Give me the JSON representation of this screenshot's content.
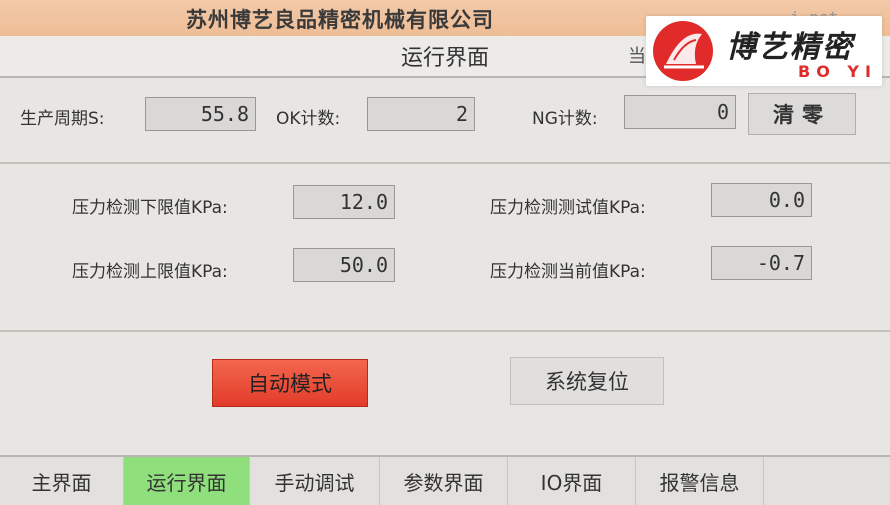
{
  "header": {
    "company": "苏州博艺良品精密机械有限公司",
    "site": "i.net",
    "title": "运行界面",
    "current_user_fragment": "当"
  },
  "logo": {
    "brand": "博艺精密",
    "sub": "BO YI",
    "accent_color": "#e12b2b"
  },
  "counters": {
    "cycle_label": "生产周期S:",
    "cycle_value": "55.8",
    "ok_label": "OK计数:",
    "ok_value": "2",
    "ng_label": "NG计数:",
    "ng_value": "0",
    "clear_label": "清零"
  },
  "pressure": {
    "lower_label": "压力检测下限值KPa:",
    "lower_value": "12.0",
    "upper_label": "压力检测上限值KPa:",
    "upper_value": "50.0",
    "test_label": "压力检测测试值KPa:",
    "test_value": "0.0",
    "current_label": "压力检测当前值KPa:",
    "current_value": "-0.7"
  },
  "actions": {
    "auto_mode": "自动模式",
    "system_reset": "系统复位",
    "auto_color": "#e9442f"
  },
  "nav": {
    "active_color": "#8fe07c",
    "tabs": [
      {
        "label": "主界面"
      },
      {
        "label": "运行界面"
      },
      {
        "label": "手动调试"
      },
      {
        "label": "参数界面"
      },
      {
        "label": "IO界面"
      },
      {
        "label": "报警信息"
      }
    ]
  }
}
